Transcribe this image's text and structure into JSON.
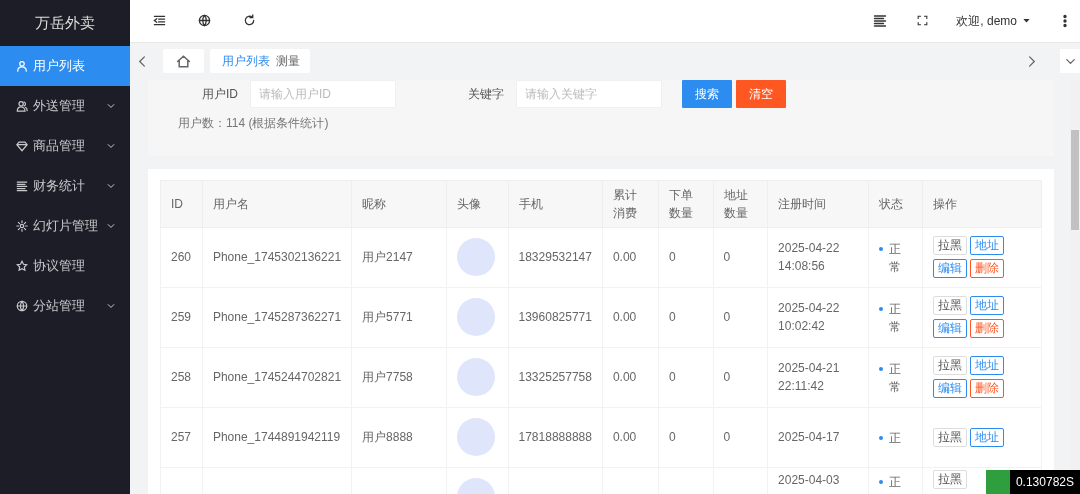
{
  "brand": "万岳外卖",
  "sidebar": {
    "items": [
      {
        "label": "用户列表",
        "selected": true,
        "expandable": false
      },
      {
        "label": "外送管理",
        "selected": false,
        "expandable": true
      },
      {
        "label": "商品管理",
        "selected": false,
        "expandable": true
      },
      {
        "label": "财务统计",
        "selected": false,
        "expandable": true
      },
      {
        "label": "幻灯片管理",
        "selected": false,
        "expandable": true
      },
      {
        "label": "协议管理",
        "selected": false,
        "expandable": false
      },
      {
        "label": "分站管理",
        "selected": false,
        "expandable": true
      }
    ]
  },
  "topbar": {
    "user": "欢迎, demo"
  },
  "tabs": [
    {
      "label": "用户列表",
      "selected": true
    },
    {
      "label": "测量",
      "selected": false
    }
  ],
  "filters": {
    "fields": [
      {
        "label": "用户ID",
        "placeholder": "请输入用户ID"
      },
      {
        "label": "关键字",
        "placeholder": "请输入关键字"
      }
    ],
    "buttons": [
      {
        "label": "搜索",
        "kind": "primary"
      },
      {
        "label": "清空",
        "kind": "danger"
      }
    ],
    "summary": "用户数：114 (根据条件统计)"
  },
  "table": {
    "columns": [
      "ID",
      "用户名",
      "昵称",
      "头像",
      "手机",
      "累计消费",
      "下单数量",
      "地址数量",
      "注册时间",
      "状态",
      "操作"
    ],
    "rows": [
      {
        "id": "260",
        "username": "Phone_1745302136221",
        "nickname": "用户2147",
        "phone": "18329532147",
        "spent": "0.00",
        "orders": "0",
        "addresses": "0",
        "registered": "2025-04-22 14:08:56",
        "status": {
          "label": "正常",
          "kind": "normal"
        },
        "actions": [
          {
            "label": "拉黑",
            "kind": "plain"
          },
          {
            "label": "地址",
            "kind": "info"
          },
          {
            "label": "编辑",
            "kind": "info"
          },
          {
            "label": "删除",
            "kind": "danger"
          }
        ]
      },
      {
        "id": "259",
        "username": "Phone_1745287362271",
        "nickname": "用户5771",
        "phone": "13960825771",
        "spent": "0.00",
        "orders": "0",
        "addresses": "0",
        "registered": "2025-04-22 10:02:42",
        "status": {
          "label": "正常",
          "kind": "normal"
        },
        "actions": [
          {
            "label": "拉黑",
            "kind": "plain"
          },
          {
            "label": "地址",
            "kind": "info"
          },
          {
            "label": "编辑",
            "kind": "info"
          },
          {
            "label": "删除",
            "kind": "danger"
          }
        ]
      },
      {
        "id": "258",
        "username": "Phone_1745244702821",
        "nickname": "用户7758",
        "phone": "13325257758",
        "spent": "0.00",
        "orders": "0",
        "addresses": "0",
        "registered": "2025-04-21 22:11:42",
        "status": {
          "label": "正常",
          "kind": "normal"
        },
        "actions": [
          {
            "label": "拉黑",
            "kind": "plain"
          },
          {
            "label": "地址",
            "kind": "info"
          },
          {
            "label": "编辑",
            "kind": "info"
          },
          {
            "label": "删除",
            "kind": "danger"
          }
        ]
      },
      {
        "id": "257",
        "username": "Phone_1744891942119",
        "nickname": "用户8888",
        "phone": "17818888888",
        "spent": "0.00",
        "orders": "0",
        "addresses": "0",
        "registered": "2025-04-17",
        "status": {
          "label": "正",
          "kind": "normal"
        },
        "actions": [
          {
            "label": "拉黑",
            "kind": "plain"
          },
          {
            "label": "地址",
            "kind": "info"
          }
        ]
      },
      {
        "registered": "2025-04-03",
        "status": {
          "label": "正",
          "kind": "normal"
        },
        "actions": [
          {
            "label": "拉黑",
            "kind": "plain"
          }
        ]
      }
    ]
  },
  "trace_badge": "0.130782S"
}
